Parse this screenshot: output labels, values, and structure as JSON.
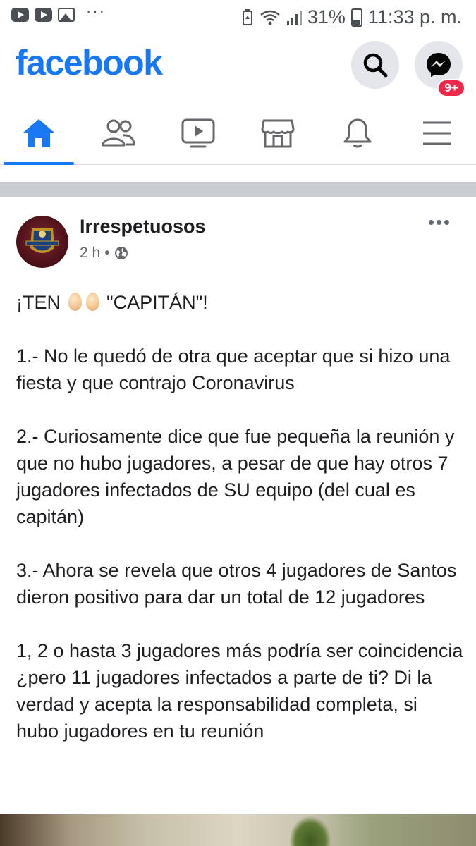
{
  "status_bar": {
    "battery": "31%",
    "time": "11:33 p. m."
  },
  "header": {
    "logo": "facebook",
    "messenger_badge": "9+"
  },
  "nav": {
    "active_tab": "home",
    "tabs": [
      "home",
      "friends",
      "watch",
      "marketplace",
      "notifications",
      "menu"
    ]
  },
  "post": {
    "author": "Irrespetuosos",
    "time": "2 h",
    "separator": "•",
    "privacy_icon": "globe-icon",
    "title_pre": "¡TEN",
    "title_post": "\"CAPITÁN\"!",
    "paragraphs": [
      "1.-  No le quedó de otra que aceptar que si hizo una fiesta y que contrajo Coronavirus",
      "2.- Curiosamente dice que fue pequeña la reunión y que no hubo jugadores, a pesar de que hay otros 7 jugadores infectados de SU equipo (del cual es capitán)",
      "3.- Ahora se revela que otros 4 jugadores de Santos dieron positivo para dar un total de 12 jugadores",
      "1, 2 o hasta 3 jugadores más podría ser coincidencia ¿pero 11 jugadores infectados a parte de ti? Di la verdad y acepta la responsabilidad completa, si hubo jugadores en tu reunión"
    ]
  },
  "colors": {
    "brand": "#1877f2",
    "badge": "#f02849",
    "text": "#1c1e21",
    "secondary": "#65676b"
  }
}
